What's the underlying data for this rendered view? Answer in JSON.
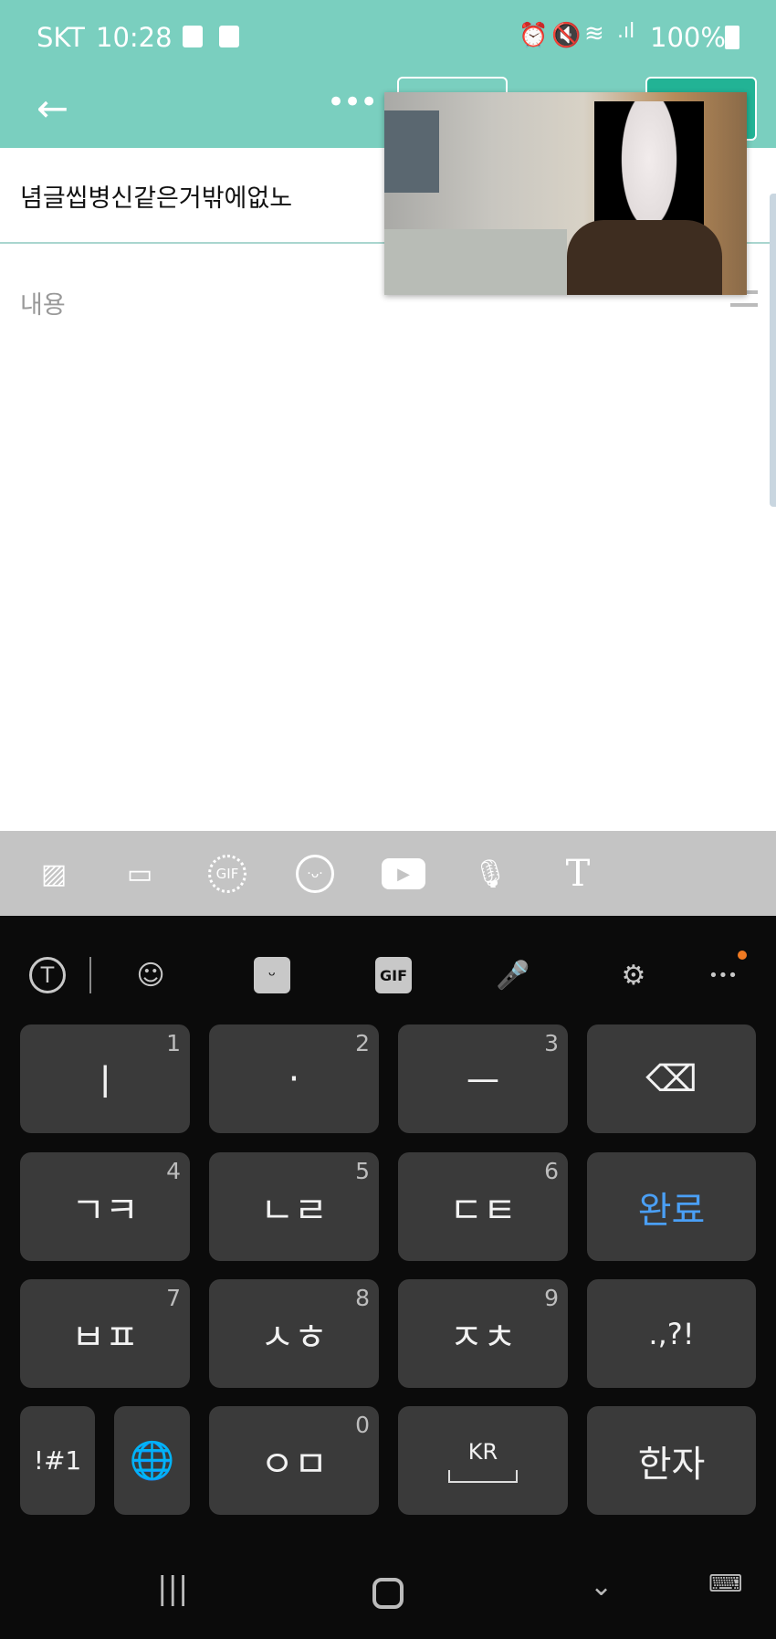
{
  "status_bar": {
    "carrier": "SKT",
    "time": "10:28",
    "battery": "100%",
    "icons": [
      "alarm-icon",
      "mute-icon",
      "wifi-icon",
      "signal-icon",
      "battery-icon"
    ]
  },
  "app_bar": {
    "back_icon": "arrow-left-icon",
    "more_icon": "more-horizontal-icon"
  },
  "post": {
    "title": "념글씹병신같은거밖에없노",
    "content_placeholder": "내용"
  },
  "media_toolbar": {
    "icons": [
      "image-icon",
      "video-icon",
      "gif-icon",
      "emoticon-icon",
      "youtube-icon",
      "mic-icon",
      "text-icon"
    ]
  },
  "keyboard": {
    "toolbar_icons": [
      "translate-icon",
      "emoji-icon",
      "sticker-icon",
      "gif-icon",
      "mic-icon",
      "settings-icon",
      "more-icon"
    ],
    "gif_label": "GIF",
    "rows": [
      [
        {
          "label": "ㅣ",
          "num": "1"
        },
        {
          "label": "·",
          "num": "2"
        },
        {
          "label": "ㅡ",
          "num": "3"
        },
        {
          "label": "⌫"
        }
      ],
      [
        {
          "label": "ㄱㅋ",
          "num": "4"
        },
        {
          "label": "ㄴㄹ",
          "num": "5"
        },
        {
          "label": "ㄷㅌ",
          "num": "6"
        },
        {
          "label": "완료"
        }
      ],
      [
        {
          "label": "ㅂㅍ",
          "num": "7"
        },
        {
          "label": "ㅅㅎ",
          "num": "8"
        },
        {
          "label": "ㅈㅊ",
          "num": "9"
        },
        {
          "label": ".,?!"
        }
      ],
      [
        {
          "label": "!#1"
        },
        {
          "label": "🌐"
        },
        {
          "label": "ㅇㅁ",
          "num": "0"
        },
        {
          "label": "KR"
        },
        {
          "label": "한자"
        }
      ]
    ],
    "accent": "#4a9ff5"
  }
}
